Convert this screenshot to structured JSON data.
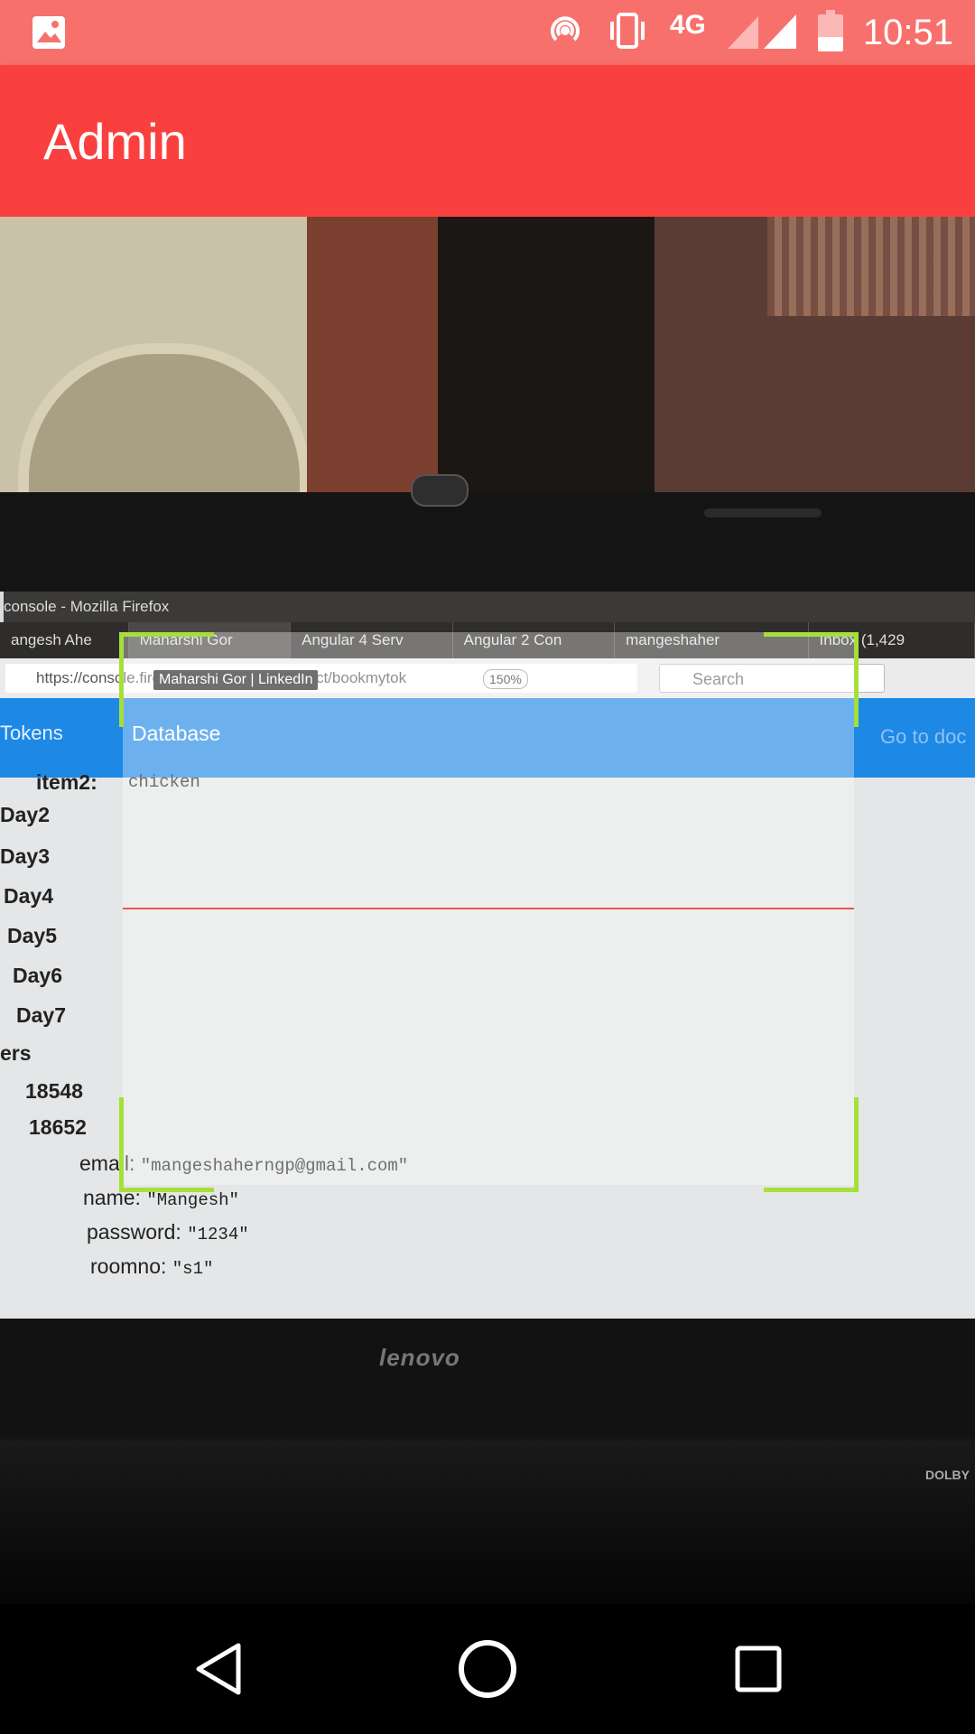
{
  "status_bar": {
    "time": "10:51",
    "network": "4G",
    "icons": [
      "image-icon",
      "hotspot-icon",
      "vibrate-icon",
      "signal-icon",
      "battery-icon"
    ]
  },
  "app_bar": {
    "title": "Admin"
  },
  "camera_preview": {
    "window_title": "console - Mozilla Firefox",
    "tabs": [
      "angesh Ahe",
      "Maharshi Gor",
      "Angular 4 Serv",
      "Angular 2 Con",
      "mangeshaher",
      "Inbox (1,429"
    ],
    "url": "https://console.firebase.google.com/project/bookmytok",
    "zoom": "150%",
    "search_placeholder": "Search",
    "tooltip": "Maharshi Gor | LinkedIn",
    "firebase": {
      "tokens_label": "Tokens",
      "database_label": "Database",
      "goto_label": "Go to doc"
    },
    "tree": {
      "item2_key": "item2:",
      "item2_val": "chicken",
      "days": [
        "Day2",
        "Day3",
        "Day4",
        "Day5",
        "Day6",
        "Day7"
      ],
      "users_label": "ers",
      "user_ids": [
        "18548",
        "18652"
      ],
      "fields": [
        {
          "key": "email:",
          "value": "\"mangeshaherngp@gmail.com\""
        },
        {
          "key": "name:",
          "value": "\"Mangesh\""
        },
        {
          "key": "password:",
          "value": "\"1234\""
        },
        {
          "key": "roomno:",
          "value": "\"s1\""
        }
      ]
    },
    "laptop_brand": "lenovo",
    "dolby_label": "DOLBY"
  },
  "colors": {
    "status_bar": "#f8706c",
    "app_bar": "#fa403f",
    "scanner_corner": "#a6df3a",
    "scan_line": "#e35b4f"
  }
}
